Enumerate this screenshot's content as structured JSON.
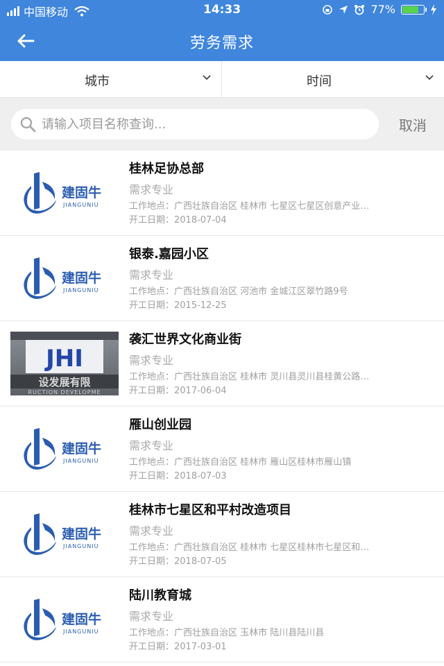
{
  "status_bar": {
    "carrier": "中国移动",
    "time": "14:33",
    "battery_text": "77%",
    "battery_level": 0.77,
    "icons": [
      "signal-bars-icon",
      "wifi-icon",
      "lock-rotation-icon",
      "location-arrow-icon",
      "alarm-icon",
      "battery-icon",
      "charging-icon"
    ]
  },
  "nav": {
    "title": "劳务需求",
    "back_icon": "back-arrow-icon"
  },
  "filters": {
    "city": "城市",
    "time": "时间"
  },
  "search": {
    "placeholder": "请输入项目名称查询...",
    "cancel": "取消"
  },
  "logo": {
    "brand": "建固牛",
    "brand_en": "JIANGUNIU"
  },
  "photo": {
    "sign_letters": "JHI",
    "sign_text": "设发展有限",
    "sign_text_en": "RUCTION DEVELOPME"
  },
  "colors": {
    "accent": "#3f86dc",
    "logo_blue": "#2a5db0",
    "battery_green": "#59d34e"
  },
  "projects": [
    {
      "name": "桂林足协总部",
      "category": "需求专业",
      "location": "工作地点：广西壮族自治区 桂林市 七星区七星区创意产业…",
      "start_date": "开工日期：2018-07-04",
      "thumb": "logo"
    },
    {
      "name": "银泰.嘉园小区",
      "category": "需求专业",
      "location": "工作地点：广西壮族自治区 河池市 金城江区翠竹路9号",
      "start_date": "开工日期：2015-12-25",
      "thumb": "logo"
    },
    {
      "name": "袭汇世界文化商业街",
      "category": "需求专业",
      "location": "工作地点：广西壮族自治区 桂林市 灵川县灵川县桂黄公路…",
      "start_date": "开工日期：2017-06-04",
      "thumb": "photo"
    },
    {
      "name": "雁山创业园",
      "category": "需求专业",
      "location": "工作地点：广西壮族自治区 桂林市 雁山区桂林市雁山镇",
      "start_date": "开工日期：2018-07-03",
      "thumb": "logo"
    },
    {
      "name": "桂林市七星区和平村改造项目",
      "category": "需求专业",
      "location": "工作地点：广西壮族自治区 桂林市 七星区桂林市七星区和…",
      "start_date": "开工日期：2018-07-05",
      "thumb": "logo"
    },
    {
      "name": "陆川教育城",
      "category": "需求专业",
      "location": "工作地点：广西壮族自治区 玉林市 陆川县陆川县",
      "start_date": "开工日期：2017-03-01",
      "thumb": "logo"
    }
  ]
}
